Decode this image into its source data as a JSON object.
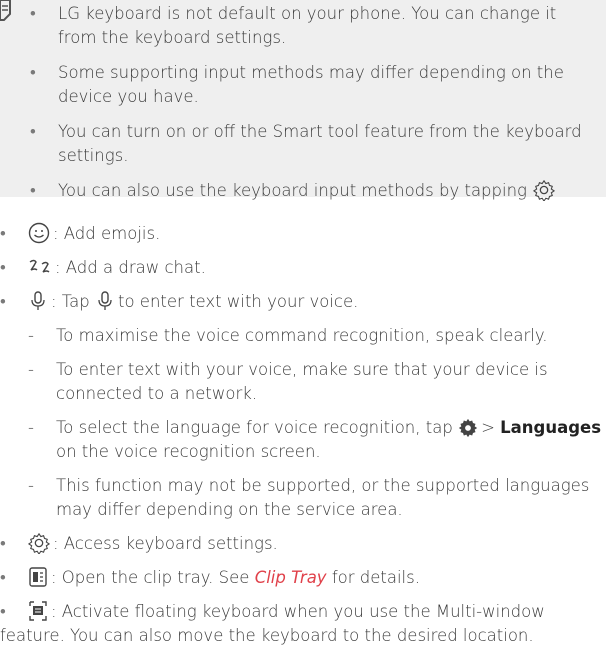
{
  "note": {
    "items": [
      "LG keyboard is not default on your phone. You can change it from the keyboard settings.",
      "Some supporting input methods may differ depending on the device you have.",
      "You can turn on or off the Smart tool feature from the keyboard settings.",
      "You can also use the keyboard input methods by tapping"
    ]
  },
  "list": {
    "emoji": ": Add emojis.",
    "draw": ": Add a draw chat.",
    "voice_pre": ": Tap",
    "voice_post": "to enter text with your voice.",
    "sub": [
      "To maximise the voice command recognition, speak clearly.",
      "To enter text with your voice, make sure that your device is connected to a network."
    ],
    "lang_pre": "To select the language for voice recognition, tap",
    "lang_sep": ">",
    "lang_bold": "Languages",
    "lang_post": "on the voice recognition screen.",
    "sub_last": "This function may not be supported, or the supported languages may differ depending on the service area.",
    "settings": ": Access keyboard settings.",
    "clip_pre": ": Open the clip tray. See",
    "clip_link": "Clip Tray",
    "clip_post": "for details.",
    "float_line1": ": Activate floating keyboard when you use the Multi-window",
    "float_line2": "feature. You can also move the keyboard to the desired location."
  }
}
